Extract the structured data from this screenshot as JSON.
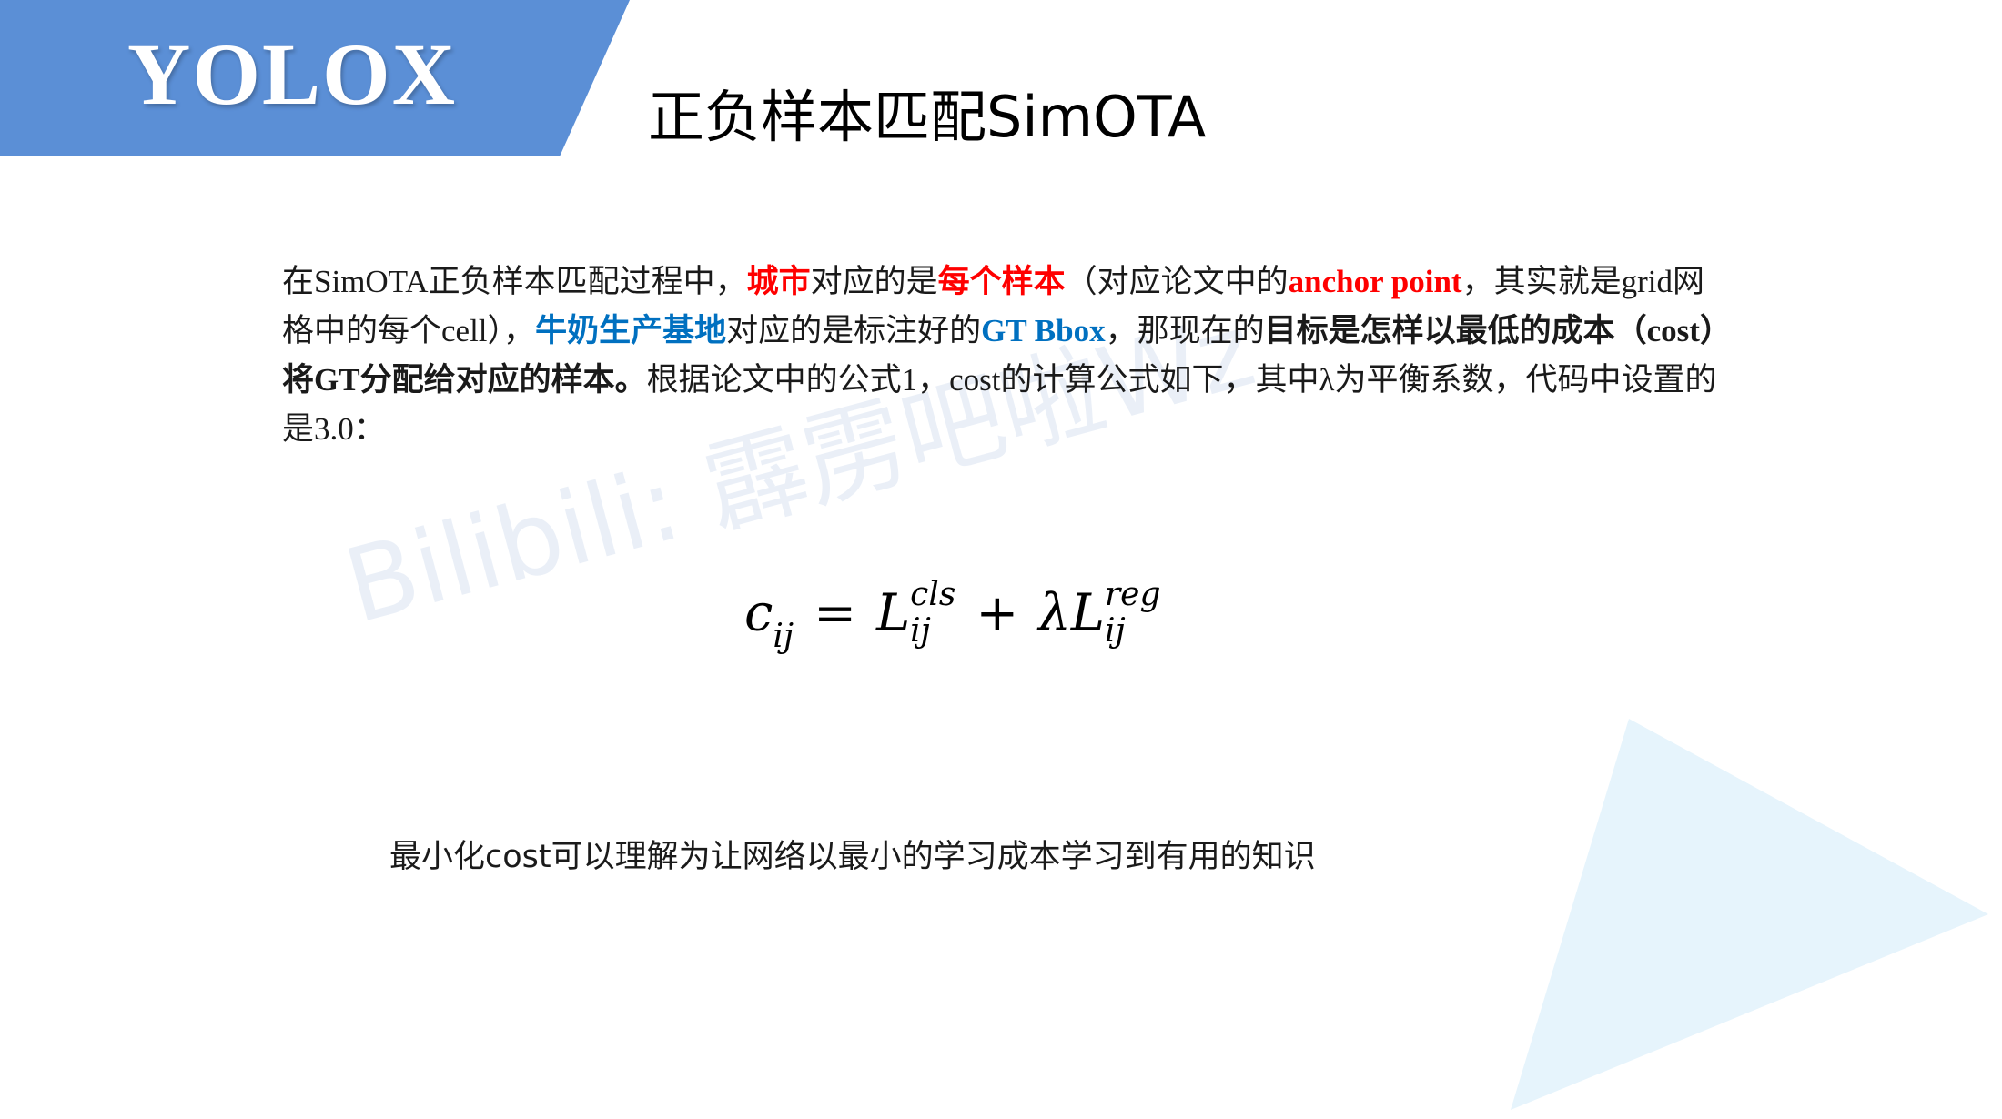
{
  "colors": {
    "brand_blue": "#5b8fd6",
    "highlight_red": "#ff0000",
    "highlight_blue": "#0070c0",
    "triangle_tint": "#e6f4fc",
    "watermark": "#1f5bb0"
  },
  "header": {
    "brand": "YOLOX",
    "title": "正负样本匹配SimOTA"
  },
  "watermark": "Bilibili: 霹雳吧啦Wz",
  "paragraph": {
    "p1": "在",
    "p2": "SimOTA",
    "p3": "正负样本匹配过程中，",
    "p4_red": "城市",
    "p5": "对应的是",
    "p6_red": "每个样本",
    "p7": "（对应论文中的",
    "p8_red": "anchor point",
    "p9": "，其实就是",
    "p10": "grid",
    "p11": "网格中的每个",
    "p12": "cell",
    "p13": "），",
    "p14_blue": "牛奶生产基地",
    "p15": "对应的是标注好的",
    "p16_blue": "GT Bbox",
    "p17": "，那现在的",
    "p18_bold": "目标是怎样以最低的成本（",
    "p19_bold": "cost",
    "p20_bold": "）将",
    "p21_bold": "GT",
    "p22_bold": "分配给对应的样本。",
    "p23": "根据论文中的公式",
    "p24": "1",
    "p25": "，",
    "p26": "cost",
    "p27": "的计算公式如下，其中",
    "p28": "λ",
    "p29": "为平衡系数，代码中设置的是",
    "p30": "3.0",
    "p31": "："
  },
  "formula": {
    "lhs": "c",
    "lhs_sub": "ij",
    "eq": "=",
    "term1": "L",
    "term1_sup": "cls",
    "term1_sub": "ij",
    "plus": "+",
    "lambda": "λ",
    "term2": "L",
    "term2_sup": "reg",
    "term2_sub": "ij"
  },
  "summary": "最小化cost可以理解为让网络以最小的学习成本学习到有用的知识"
}
